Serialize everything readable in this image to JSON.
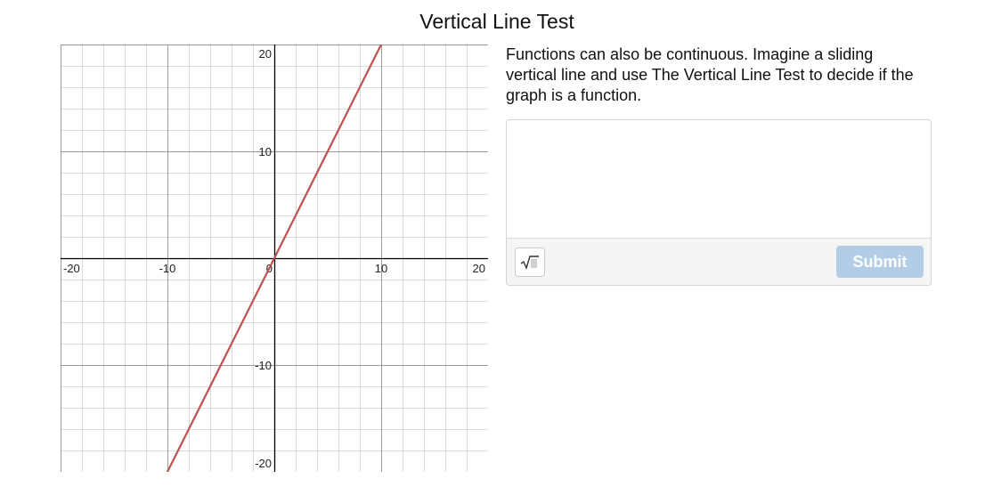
{
  "page": {
    "title": "Vertical Line Test"
  },
  "prompt": {
    "text": "Functions can also be continuous.  Imagine a sliding vertical line and use The Vertical Line Test to decide if the graph is a function."
  },
  "answer": {
    "value": "",
    "math_icon": "square-root-icon",
    "submit_label": "Submit"
  },
  "colors": {
    "line": "#c0504d",
    "submit_disabled": "#b3cde6",
    "grid_minor": "#dcdcdc",
    "grid_major": "#9a9a9a",
    "axis": "#000000"
  },
  "chart_data": {
    "type": "line",
    "title": "",
    "xlabel": "",
    "ylabel": "",
    "xlim": [
      -20,
      20
    ],
    "ylim": [
      -20,
      20
    ],
    "minor_grid_step": 2,
    "major_grid_step": 10,
    "grid": true,
    "x_ticks": [
      {
        "value": -20,
        "label": "-20"
      },
      {
        "value": -10,
        "label": "-10"
      },
      {
        "value": 0,
        "label": "0"
      },
      {
        "value": 10,
        "label": "10"
      },
      {
        "value": 20,
        "label": "20"
      }
    ],
    "y_ticks": [
      {
        "value": 20,
        "label": "20"
      },
      {
        "value": 10,
        "label": "10"
      },
      {
        "value": -10,
        "label": "-10"
      },
      {
        "value": -20,
        "label": "-20"
      }
    ],
    "series": [
      {
        "x": [
          -10,
          10
        ],
        "y": [
          -20,
          20
        ],
        "color": "#c0504d"
      }
    ]
  }
}
